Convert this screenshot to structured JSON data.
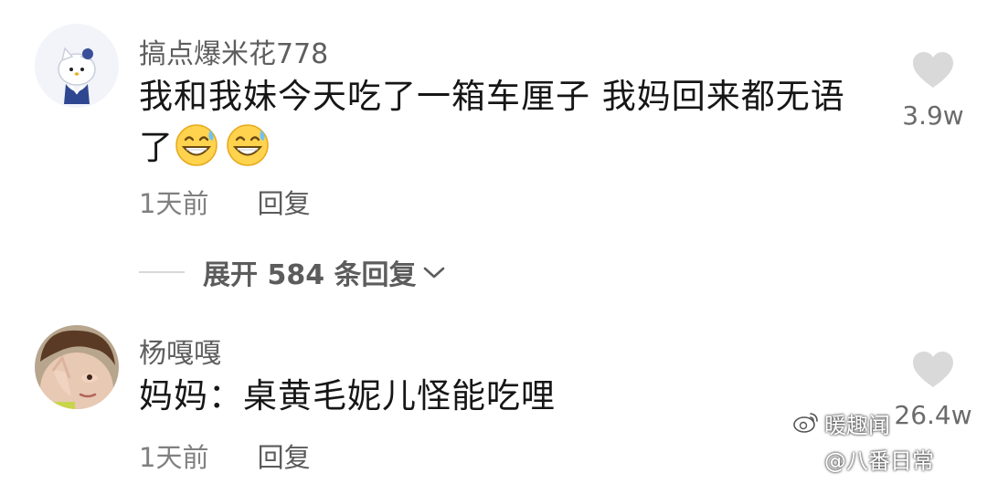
{
  "comments": [
    {
      "username": "搞点爆米花778",
      "text": "我和我妹今天吃了一箱车厘子 我妈回来都无语了",
      "emojis": [
        "grinning-sweat-emoji",
        "grinning-sweat-emoji"
      ],
      "time": "1天前",
      "reply_label": "回复",
      "like_count": "3.9w",
      "expand_label": "展开 584 条回复"
    },
    {
      "username": "杨嘎嘎",
      "text": "妈妈：桌黄毛妮儿怪能吃哩",
      "time": "1天前",
      "reply_label": "回复",
      "like_count": "26.4w"
    }
  ],
  "watermark": {
    "name": "暖趣闻",
    "handle": "@八番日常"
  },
  "colors": {
    "username": "#5e5e5e",
    "comment_text": "#161616",
    "meta": "#808080",
    "heart": "#d9d9d9"
  }
}
